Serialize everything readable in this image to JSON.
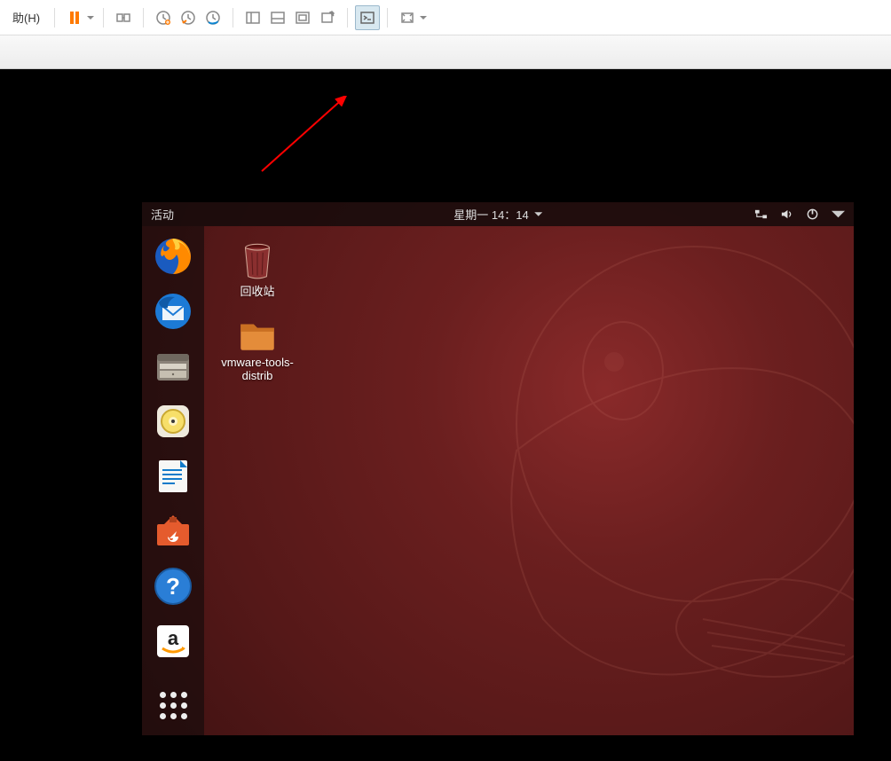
{
  "host": {
    "menu_help": "助(H)",
    "icons": {
      "pause": "pause",
      "arrow": "dropdown",
      "connect": "connect-devices",
      "snapshot": "snapshot",
      "snapshot_revert": "snapshot-revert",
      "snapshot_manage": "snapshot-manage",
      "view1": "view-thumbnails",
      "view2": "view-console",
      "view3": "view-full",
      "view4": "view-unity",
      "console": "enter-console",
      "fullscreen": "fullscreen"
    }
  },
  "ubuntu": {
    "activities": "活动",
    "clock": "星期一 14：14",
    "desktop": {
      "trash": "回收站",
      "folder": "vmware-tools-distrib"
    },
    "dock": {
      "firefox": "firefox",
      "thunderbird": "thunderbird",
      "files": "files",
      "rhythmbox": "rhythmbox",
      "writer": "libreoffice-writer",
      "software": "ubuntu-software",
      "help": "help",
      "amazon": "amazon",
      "apps": "show-applications"
    }
  }
}
